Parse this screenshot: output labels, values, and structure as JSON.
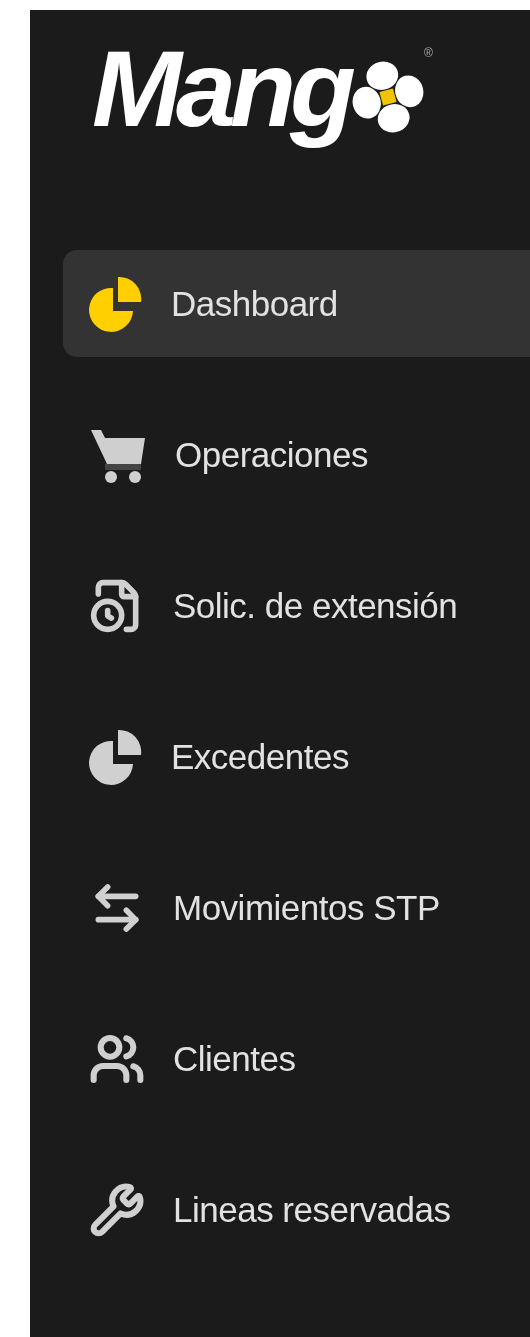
{
  "logo": {
    "text": "Mang",
    "mark": "®"
  },
  "nav": [
    {
      "label": "Dashboard",
      "selected": true
    },
    {
      "label": "Operaciones",
      "selected": false
    },
    {
      "label": "Solic. de extensión",
      "selected": false
    },
    {
      "label": "Excedentes",
      "selected": false
    },
    {
      "label": "Movimientos STP",
      "selected": false
    },
    {
      "label": "Clientes",
      "selected": false
    },
    {
      "label": "Lineas reservadas",
      "selected": false
    }
  ]
}
